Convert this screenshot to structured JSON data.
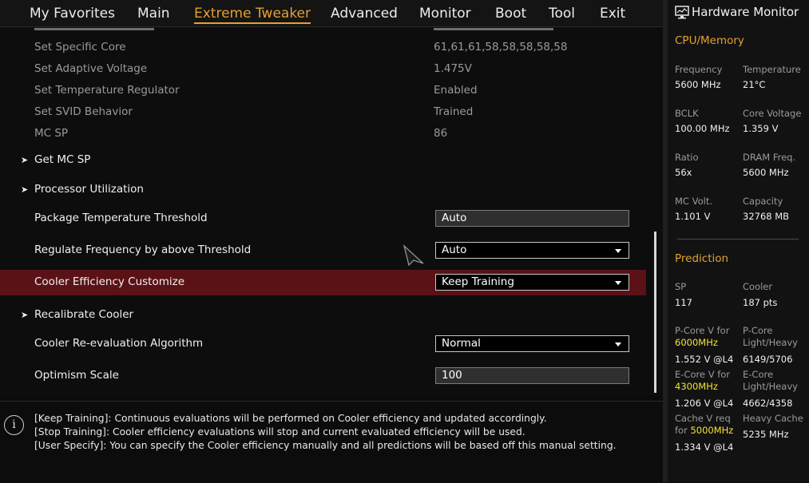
{
  "nav": {
    "tabs": [
      "My Favorites",
      "Main",
      "Extreme Tweaker",
      "Advanced",
      "Monitor",
      "Boot",
      "Tool",
      "Exit"
    ],
    "active_tab": "Extreme Tweaker"
  },
  "settings": {
    "readonly": [
      {
        "label": "Set Specific Core",
        "value": "61,61,61,58,58,58,58,58"
      },
      {
        "label": "Set Adaptive Voltage",
        "value": "1.475V"
      },
      {
        "label": "Set Temperature Regulator",
        "value": "Enabled"
      },
      {
        "label": "Set SVID Behavior",
        "value": "Trained"
      },
      {
        "label": "MC SP",
        "value": "86"
      }
    ],
    "submenus": {
      "get_mc_sp": "Get MC SP",
      "processor_utilization": "Processor Utilization",
      "recalibrate_cooler": "Recalibrate Cooler"
    },
    "options": {
      "package_temp_threshold": {
        "label": "Package Temperature Threshold",
        "value": "Auto"
      },
      "regulate_frequency": {
        "label": "Regulate Frequency by above Threshold",
        "value": "Auto"
      },
      "cooler_efficiency": {
        "label": "Cooler Efficiency Customize",
        "value": "Keep Training"
      },
      "cooler_reeval": {
        "label": "Cooler Re-evaluation Algorithm",
        "value": "Normal"
      },
      "optimism_scale": {
        "label": "Optimism Scale",
        "value": "100"
      }
    }
  },
  "help": {
    "lines": [
      "[Keep Training]: Continuous evaluations will be performed on Cooler efficiency and updated accordingly.",
      "[Stop Training]: Cooler efficiency evaluations will stop and current evaluated efficiency will be used.",
      "[User Specify]: You can specify the Cooler efficiency manually and all predictions will be based off this manual setting."
    ]
  },
  "hw_monitor": {
    "title": "Hardware Monitor",
    "cpu_memory": {
      "section": "CPU/Memory",
      "items": [
        {
          "label": "Frequency",
          "value": "5600 MHz"
        },
        {
          "label": "Temperature",
          "value": "21°C"
        },
        {
          "label": "BCLK",
          "value": "100.00 MHz"
        },
        {
          "label": "Core Voltage",
          "value": "1.359 V"
        },
        {
          "label": "Ratio",
          "value": "56x"
        },
        {
          "label": "DRAM Freq.",
          "value": "5600 MHz"
        },
        {
          "label": "MC Volt.",
          "value": "1.101 V"
        },
        {
          "label": "Capacity",
          "value": "32768 MB"
        }
      ]
    },
    "prediction": {
      "section": "Prediction",
      "sp_label": "SP",
      "sp_value": "117",
      "cooler_label": "Cooler",
      "cooler_value": "187 pts",
      "pcore_v_label": "P-Core V for",
      "pcore_v_freq": "6000MHz",
      "pcore_v_value": "1.552 V @L4",
      "pcore_lh_label1": "P-Core",
      "pcore_lh_label2": "Light/Heavy",
      "pcore_lh_value": "6149/5706",
      "ecore_v_label": "E-Core V for",
      "ecore_v_freq": "4300MHz",
      "ecore_v_value": "1.206 V @L4",
      "ecore_lh_label1": "E-Core",
      "ecore_lh_label2": "Light/Heavy",
      "ecore_lh_value": "4662/4358",
      "cache_v_label1": "Cache V req",
      "cache_v_label2": "for",
      "cache_v_freq": "5000MHz",
      "cache_v_value": "1.334 V @L4",
      "heavy_cache_label": "Heavy Cache",
      "heavy_cache_value": "5235 MHz"
    }
  },
  "colors": {
    "accent": "#e4a12f",
    "highlight_row": "#5a1216",
    "freq_highlight": "#f4e233"
  }
}
